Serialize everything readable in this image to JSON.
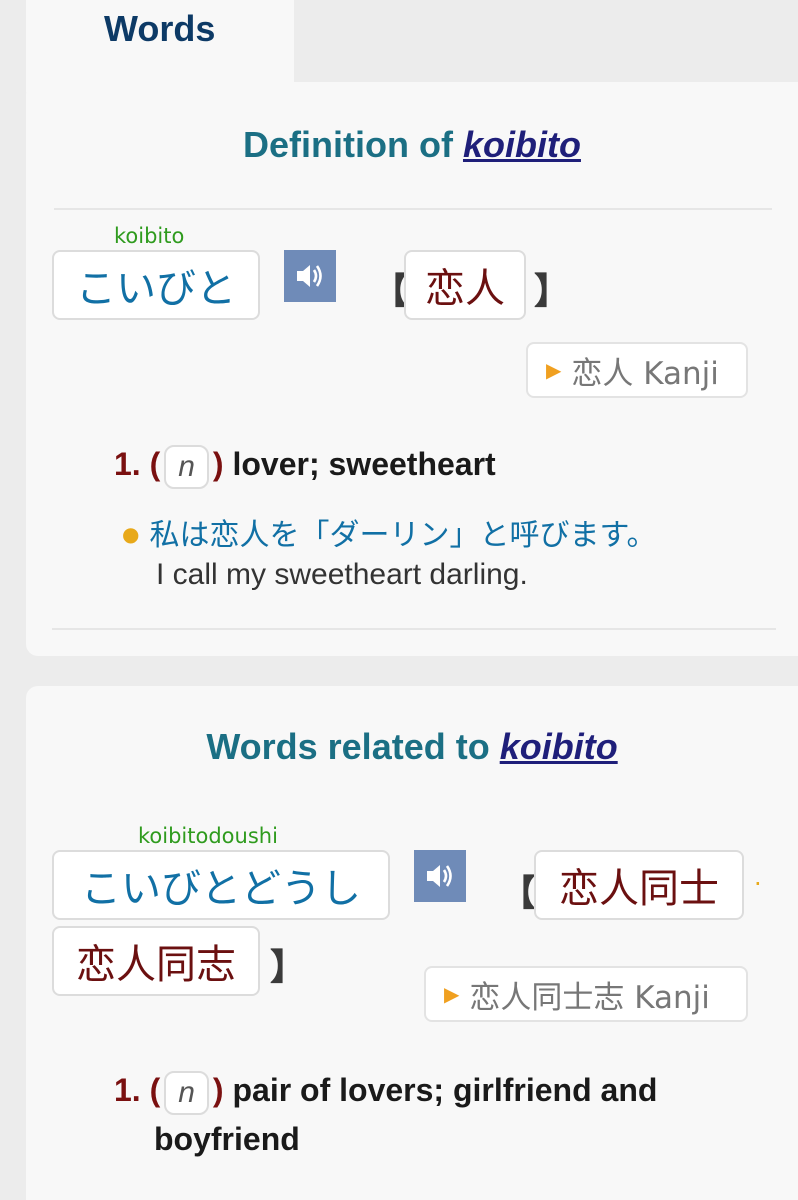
{
  "tab": {
    "label": "Words"
  },
  "definition": {
    "heading_prefix": "Definition of ",
    "heading_word": "koibito",
    "romaji": "koibito",
    "kana": "こいびと",
    "bracket_open": "【",
    "bracket_close": "】",
    "kanji": "恋人",
    "kanji_link": "恋人 Kanji",
    "sense": {
      "number": "1.",
      "open_paren": "(",
      "pos": "n",
      "close_paren": ")",
      "gloss": "lover; sweetheart"
    },
    "example": {
      "jp": "私は恋人を「ダーリン」と呼びます。",
      "en": "I call my sweetheart darling."
    }
  },
  "related": {
    "heading_prefix": "Words related to ",
    "heading_word": "koibito",
    "romaji": "koibitodoushi",
    "kana": "こいびとどうし",
    "bracket_open": "【",
    "bracket_close": "】",
    "kanji_1": "恋人同士",
    "separator": "·",
    "kanji_2": "恋人同志",
    "kanji_link": "恋人同士志 Kanji",
    "sense": {
      "number": "1.",
      "open_paren": "(",
      "pos": "n",
      "close_paren": ")",
      "gloss_line1": "pair of lovers; girlfriend and",
      "gloss_line2": "boyfriend"
    }
  },
  "icons": {
    "audio": "speaker-icon",
    "kanji_link": "play-triangle-icon",
    "example": "bullet-dot-icon"
  },
  "colors": {
    "heading": "#1b6f84",
    "heading_link": "#1f1f7a",
    "romaji": "#2f9b1e",
    "kana": "#1170a5",
    "kanji": "#6b1010",
    "accent": "#e8a91a",
    "speaker_bg": "#6f8bb8"
  }
}
